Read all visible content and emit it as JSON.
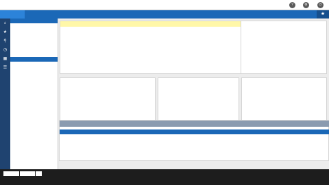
{
  "app": {
    "logo": "",
    "title": "",
    "user": ""
  },
  "icons": {
    "help": "help-icon",
    "settings": "gear-icon",
    "power": "power-icon"
  },
  "nav": {
    "edit": "",
    "new": "",
    "search": "",
    "browse": ""
  },
  "sidebar": {
    "actions_header": "",
    "actions": [
      "",
      "",
      "",
      "",
      "",
      ""
    ],
    "views_header": "",
    "views": [
      "",
      "",
      "",
      "",
      "",
      "",
      "",
      "",
      "",
      "",
      "",
      "",
      "",
      "",
      "",
      ""
    ]
  },
  "work_order": {
    "number": "",
    "created_line": "",
    "modified_line": "",
    "description": "",
    "status_label": "",
    "status": "",
    "project_label": "",
    "project": "",
    "desired_date_label": "",
    "desired_date": "",
    "budget_label": "",
    "budget": ""
  },
  "requester": {
    "department_label": "",
    "department": "",
    "department_sub": "",
    "requester_label": "",
    "requester": "",
    "contact_label": "",
    "contact": "",
    "contact_phone_label": "",
    "contact_phone": "",
    "contact_email_label": "",
    "contact_email": ""
  },
  "location": {
    "location_label": "",
    "location": "",
    "location_sub": "",
    "facility_label": "",
    "facility": "",
    "facility_sub": "",
    "property_label": "",
    "property": "",
    "property_sub": ""
  },
  "problem": {
    "header": "",
    "type_label": "",
    "type": "",
    "type_sub": "",
    "category_label": "",
    "category": "",
    "category_sub": "",
    "priority_label": "",
    "priority": "",
    "priority_sub": ""
  },
  "changes": {
    "title": "",
    "columns": [
      "",
      "",
      "",
      "",
      "",
      "",
      "",
      "",
      ""
    ],
    "rows": [
      {
        "phase": "",
        "description": "",
        "description2": "",
        "location": "",
        "shop": "",
        "work_code": "",
        "priority": "",
        "hours": "",
        "status": ""
      }
    ]
  },
  "footer": {
    "search_placeholder": "",
    "search_button": "",
    "go_button": "",
    "first": "",
    "previous": "",
    "next": "",
    "last": ""
  }
}
